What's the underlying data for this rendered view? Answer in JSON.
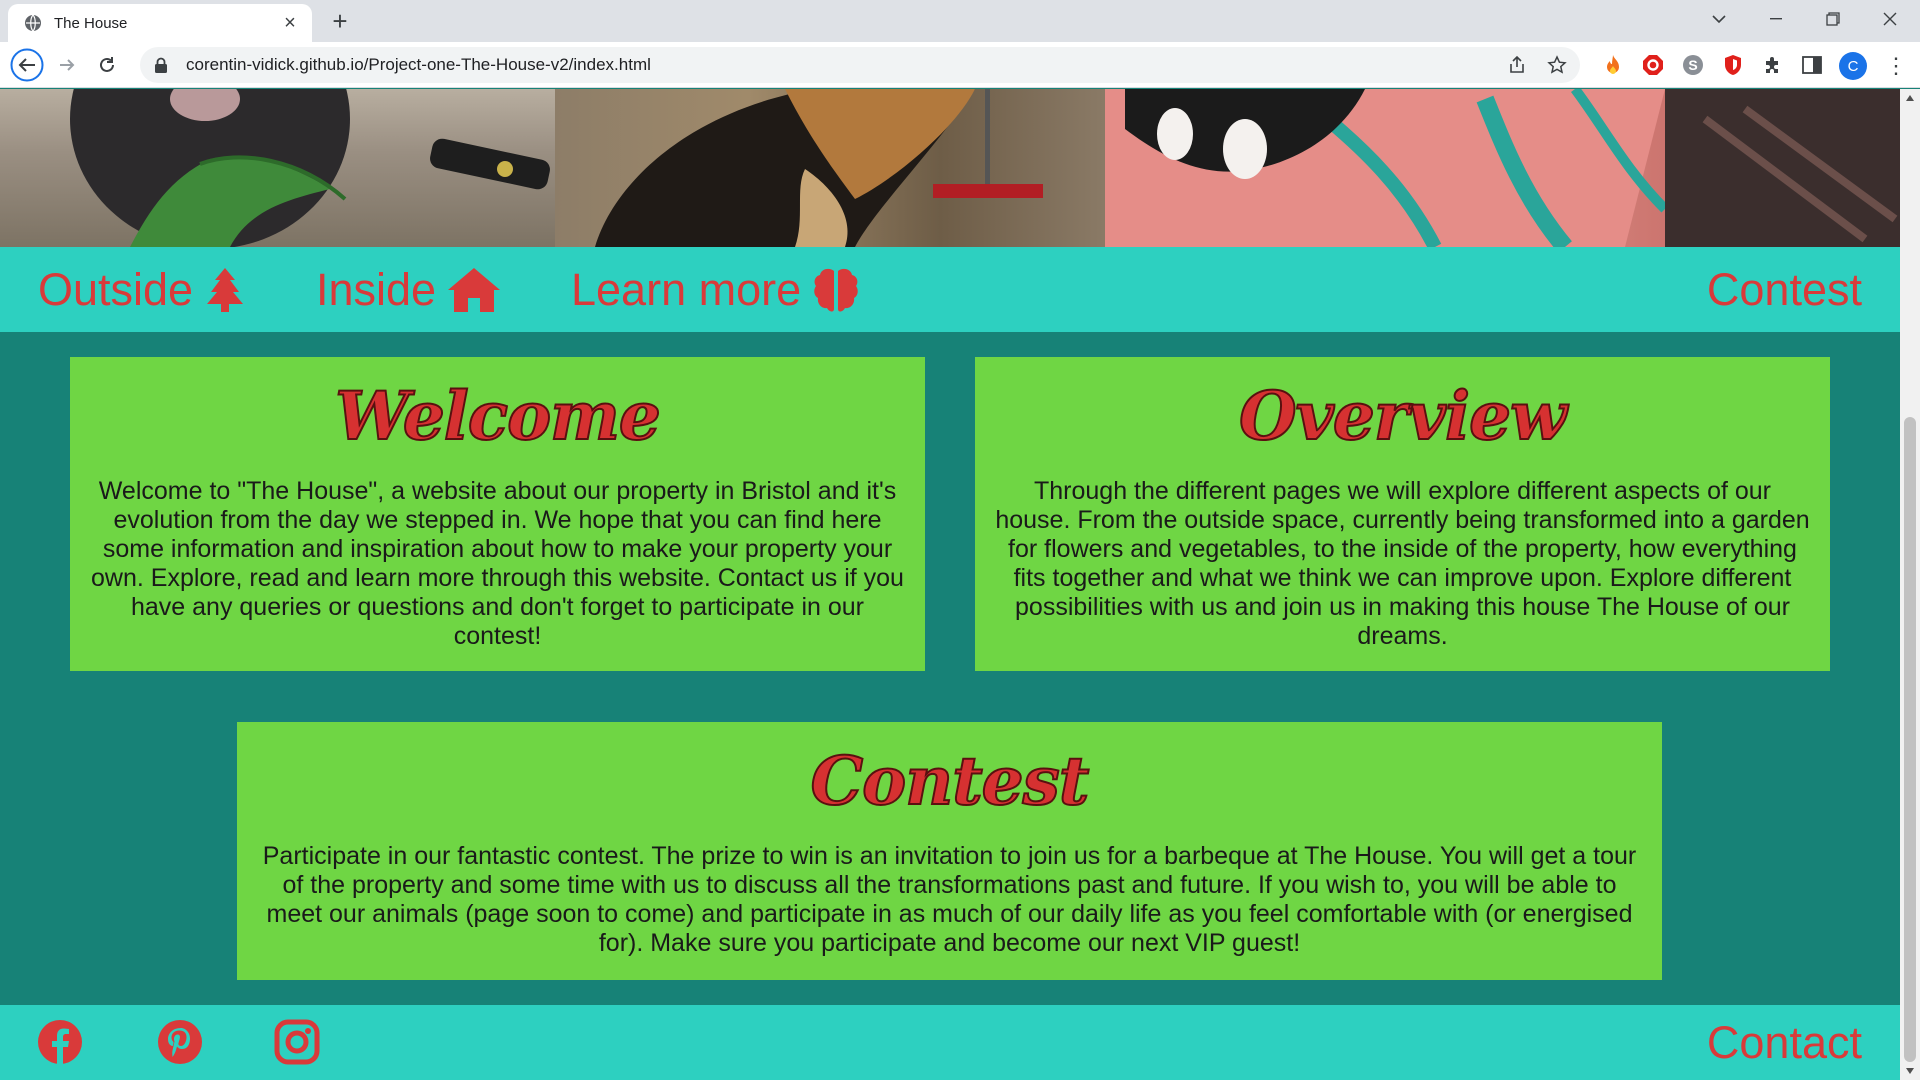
{
  "browser": {
    "tab_title": "The House",
    "url": "corentin-vidick.github.io/Project-one-The-House-v2/index.html",
    "profile_initial": "C"
  },
  "nav": {
    "outside": "Outside",
    "inside": "Inside",
    "learn_more": "Learn more",
    "contest": "Contest"
  },
  "welcome": {
    "title": "Welcome",
    "text": "Welcome to \"The House\", a website about our property in Bristol and it's evolution from the day we stepped in. We hope that you can find here some information and inspiration about how to make your property your own. Explore, read and learn more through this website. Contact us if you have any queries or questions and don't forget to participate in our contest!"
  },
  "overview": {
    "title": "Overview",
    "text": "Through the different pages we will explore different aspects of our house. From the outside space, currently being transformed into a garden for flowers and vegetables, to the inside of the property, how everything fits together and what we think we can improve upon. Explore different possibilities with us and join us in making this house The House of our dreams."
  },
  "contest": {
    "title": "Contest",
    "text": "Participate in our fantastic contest. The prize to win is an invitation to join us for a barbeque at The House. You will get a tour of the property and some time with us to discuss all the transformations past and future. If you wish to, you will be able to meet our animals (page soon to come) and participate in as much of our daily life as you feel comfortable with (or energised for). Make sure you participate and become our next VIP guest!"
  },
  "footer": {
    "contact": "Contact"
  },
  "colors": {
    "page_bg": "#178277",
    "nav_bg": "#2dd0c0",
    "card_bg": "#6fd644",
    "accent_red": "#d93a3a"
  }
}
